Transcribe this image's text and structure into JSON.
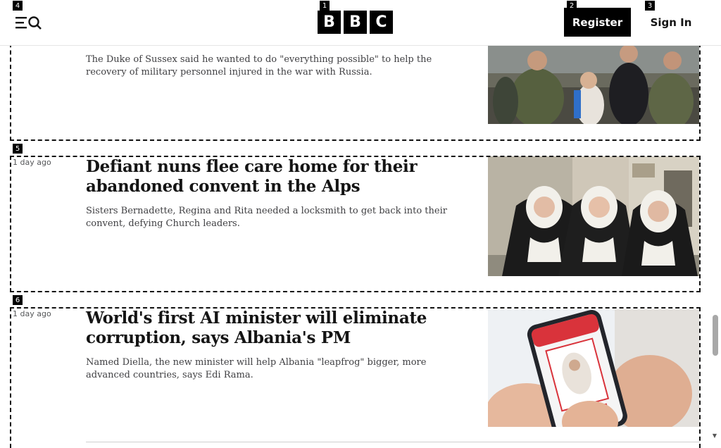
{
  "header": {
    "menu_icon": "menu-search-icon",
    "logo_letters": [
      "B",
      "B",
      "C"
    ],
    "register_label": "Register",
    "signin_label": "Sign In"
  },
  "markers": [
    "1",
    "2",
    "3",
    "4",
    "5",
    "6"
  ],
  "articles": [
    {
      "timestamp": "",
      "headline": "",
      "summary": "The Duke of Sussex said he wanted to do \"everything possible\" to help the recovery of military personnel injured in the war with Russia."
    },
    {
      "timestamp": "1 day ago",
      "headline": "Defiant nuns flee care home for their abandoned convent in the Alps",
      "summary": "Sisters Bernadette, Regina and Rita needed a locksmith to get back into their convent, defying Church leaders."
    },
    {
      "timestamp": "1 day ago",
      "headline": "World's first AI minister will eliminate corruption, says Albania's PM",
      "summary": "Named Diella, the new minister will help Albania \"leapfrog\" bigger, more advanced countries, says Edi Rama."
    }
  ],
  "scrollbar": {
    "up_glyph": "▲",
    "down_glyph": "▼"
  }
}
